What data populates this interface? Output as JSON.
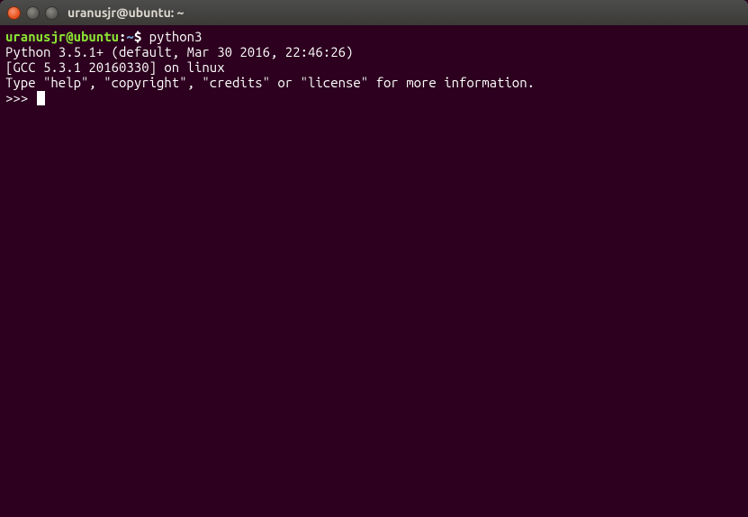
{
  "window": {
    "title": "uranusjr@ubuntu: ~"
  },
  "prompt": {
    "user_host": "uranusjr@ubuntu",
    "separator": ":",
    "path": "~",
    "symbol": "$"
  },
  "session": {
    "command": "python3",
    "output_lines": [
      "Python 3.5.1+ (default, Mar 30 2016, 22:46:26) ",
      "[GCC 5.3.1 20160330] on linux",
      "Type \"help\", \"copyright\", \"credits\" or \"license\" for more information."
    ],
    "repl_prompt": ">>> "
  }
}
